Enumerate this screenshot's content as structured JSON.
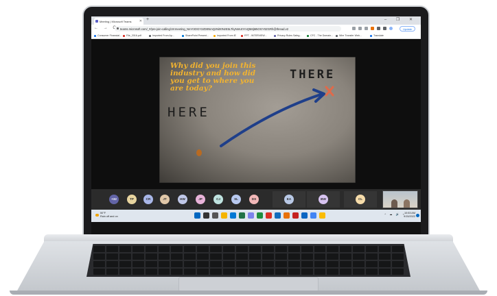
{
  "browser": {
    "tab_title": "Meeting | Microsoft Teams",
    "tab_close": "✕",
    "new_tab": "+",
    "window_controls": "–  ❐  ✕",
    "nav_icons": "← → C",
    "url": "teams.microsoft.com/_#/pre-join-calling/19:meeting_NmY3OGY2ZDItNmQzNi00NzE5LTkyNmUtYmQ5MjM5OGY0ZGRh@thread.v2",
    "profile_label": "Update"
  },
  "bookmarks": [
    {
      "label": "Consumer Financial...",
      "color": "#1a73e8"
    },
    {
      "label": "File_2016.pdf",
      "color": "#d93025"
    },
    {
      "label": "Imported From Ap...",
      "color": "#5f6368"
    },
    {
      "label": "SharePoint Present...",
      "color": "#0078d4"
    },
    {
      "label": "Imported From IE",
      "color": "#f9ab00"
    },
    {
      "label": "FPT - INTERVIEW...",
      "color": "#d93025"
    },
    {
      "label": "Privacy Rules Safeg...",
      "color": "#6264a7"
    },
    {
      "label": "CFC - The Domain...",
      "color": "#188038"
    },
    {
      "label": "Wire Transfer Web...",
      "color": "#5f6368"
    },
    {
      "label": "Translate",
      "color": "#1a73e8"
    }
  ],
  "video": {
    "question": "Why did you join this industry and how did you get to where you are today?",
    "word_there": "THERE",
    "word_here": "HERE"
  },
  "participants": [
    {
      "initials": "+32",
      "color": "#6264a7"
    },
    {
      "initials": "TP",
      "color": "#e8d5a0"
    },
    {
      "initials": "CR",
      "color": "#a9b7e8"
    },
    {
      "initials": "JT",
      "color": "#e0c7a8"
    },
    {
      "initials": "HW",
      "color": "#c0c8e8"
    },
    {
      "initials": "JP",
      "color": "#e8b3d9"
    },
    {
      "initials": "CJ",
      "color": "#bfe3e0"
    },
    {
      "initials": "SL",
      "color": "#b8c9f0"
    },
    {
      "initials": "DS",
      "color": "#f2b8b8"
    },
    {
      "initials": "EA",
      "color": "#b9c9e6"
    },
    {
      "initials": "BW",
      "color": "#d7c3f0"
    },
    {
      "initials": "CL",
      "color": "#f6dcaa"
    }
  ],
  "taskbar": {
    "weather_temp": "50°F",
    "weather_desc": "Rain off and on",
    "tray": "^ ☁ 🔊 ⌁",
    "time": "10:53 AM",
    "date": "9/15/2022"
  },
  "app_colors": [
    "#0067c0",
    "#333333",
    "#555555",
    "#f5b400",
    "#0078d4",
    "#217346",
    "#7b83eb",
    "#1e8e3e",
    "#d93025",
    "#0f6cbd",
    "#e8710a",
    "#c5221f",
    "#0a66c2",
    "#4285f4",
    "#fbbc04"
  ]
}
